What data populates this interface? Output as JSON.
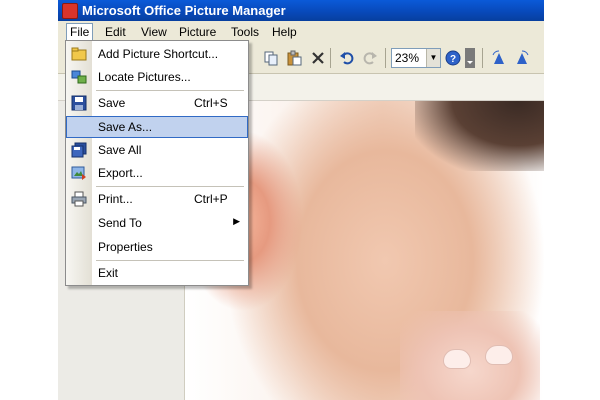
{
  "window": {
    "title": "Microsoft Office Picture Manager"
  },
  "menubar": {
    "items": [
      {
        "label": "File"
      },
      {
        "label": "Edit"
      },
      {
        "label": "View"
      },
      {
        "label": "Picture"
      },
      {
        "label": "Tools"
      },
      {
        "label": "Help"
      }
    ]
  },
  "toolbar": {
    "zoom_value": "23%"
  },
  "file_menu": {
    "add_shortcut": {
      "label": "Add Picture Shortcut..."
    },
    "locate": {
      "label": "Locate Pictures..."
    },
    "save": {
      "label": "Save",
      "shortcut": "Ctrl+S"
    },
    "save_as": {
      "label": "Save As..."
    },
    "save_all": {
      "label": "Save All"
    },
    "export": {
      "label": "Export..."
    },
    "print": {
      "label": "Print...",
      "shortcut": "Ctrl+P"
    },
    "send_to": {
      "label": "Send To",
      "submenu_arrow": "▶"
    },
    "properties": {
      "label": "Properties"
    },
    "exit": {
      "label": "Exit"
    }
  },
  "colors": {
    "titlebar": "#0a5ad8",
    "menu_highlight": "#c1d2ee",
    "menu_highlight_border": "#316ac5",
    "chrome": "#ece9d8"
  }
}
